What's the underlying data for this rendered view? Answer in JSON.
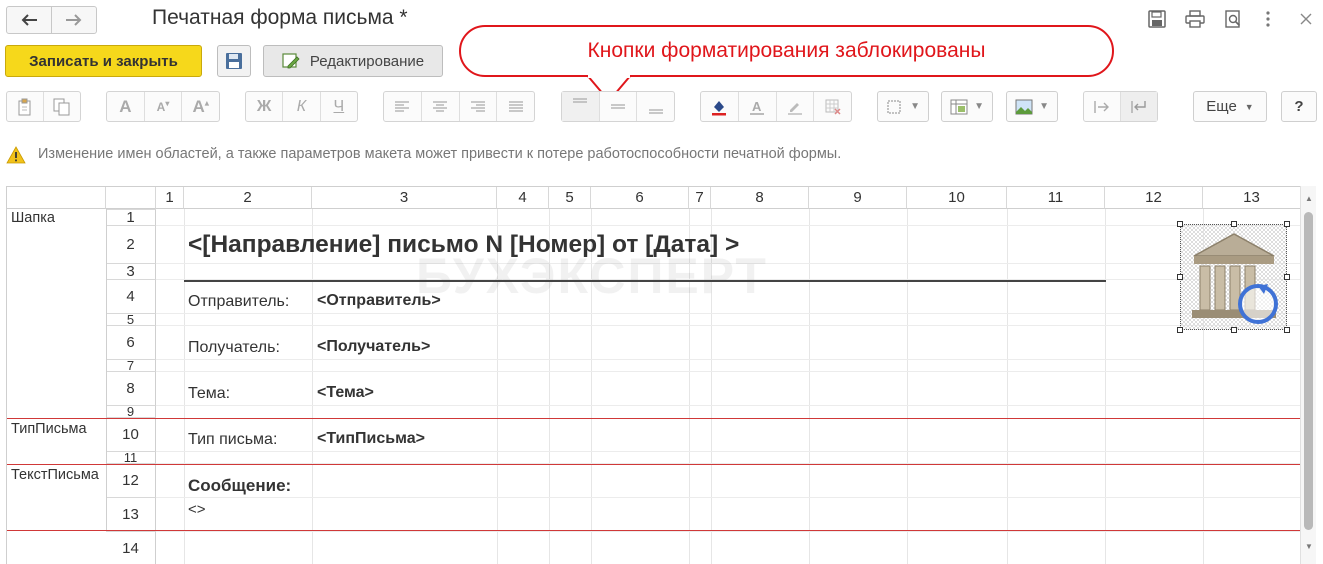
{
  "window": {
    "title": "Печатная форма письма *"
  },
  "toolbar": {
    "save_close_label": "Записать и закрыть",
    "edit_label": "Редактирование",
    "more_label": "Еще",
    "help_label": "?"
  },
  "format_toolbar": {
    "bold": "Ж",
    "italic": "К",
    "underline": "Ч",
    "font_a": "A"
  },
  "callout": {
    "text": "Кнопки форматирования заблокированы"
  },
  "warning": {
    "text": "Изменение имен областей, а также параметров макета может привести к потере работоспособности печатной формы."
  },
  "sheet": {
    "columns": [
      "1",
      "2",
      "3",
      "4",
      "5",
      "6",
      "7",
      "8",
      "9",
      "10",
      "11",
      "12",
      "13"
    ],
    "rows": [
      "1",
      "2",
      "3",
      "4",
      "5",
      "6",
      "7",
      "8",
      "9",
      "10",
      "11",
      "12",
      "13",
      "14"
    ],
    "areas": [
      "Шапка",
      "ТипПисьма",
      "ТекстПисьма"
    ],
    "doc_title": "<[Направление] письмо N [Номер] от [Дата] >",
    "sender_label": "Отправитель:",
    "sender_value": "<Отправитель>",
    "recipient_label": "Получатель:",
    "recipient_value": "<Получатель>",
    "subject_label": "Тема:",
    "subject_value": "<Тема>",
    "type_label": "Тип письма:",
    "type_value": "<ТипПисьма>",
    "message_label": "Сообщение:",
    "message_value": "<>",
    "watermark": "БУХЭКСПЕРТ"
  },
  "colors": {
    "accent_yellow": "#f6d81b",
    "callout_red": "#e0161b",
    "area_divider": "#d03838"
  }
}
